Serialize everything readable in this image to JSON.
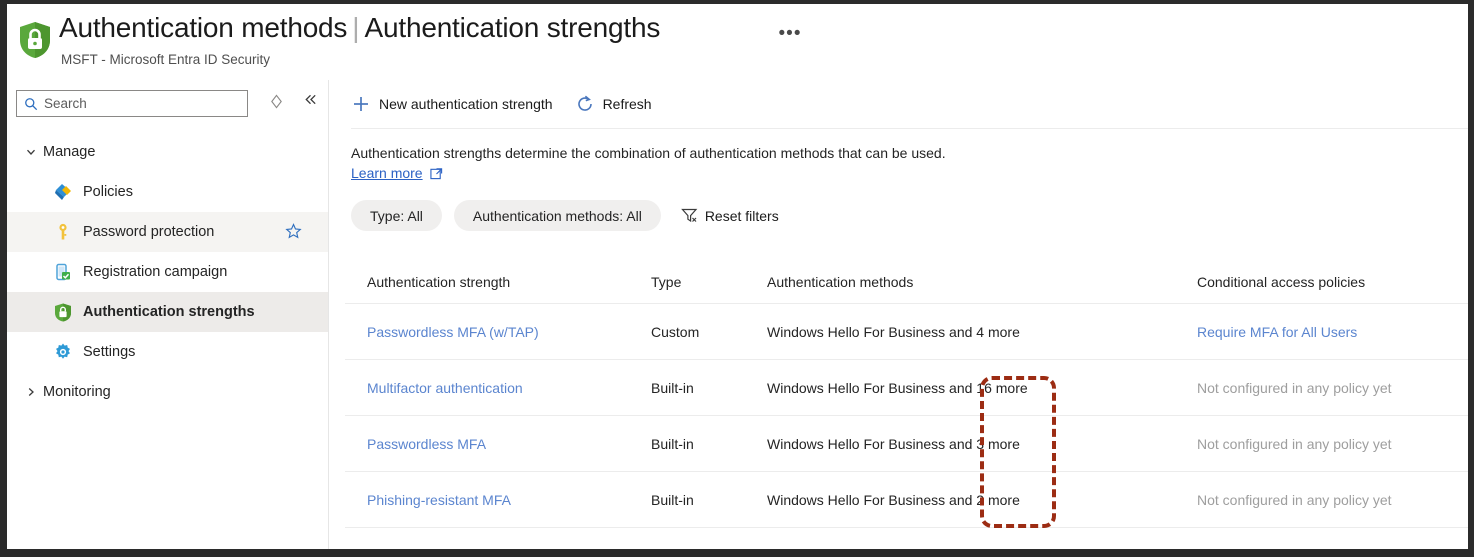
{
  "header": {
    "icon": "green-shield-lock-icon",
    "title_main": "Authentication methods",
    "title_separator": "|",
    "title_sub": "Authentication strengths",
    "overflow_label": "•••",
    "subtitle": "MSFT - Microsoft Entra ID Security"
  },
  "sidebar": {
    "search": {
      "placeholder": "Search",
      "value": "",
      "icon": "search-icon"
    },
    "refresh_icon": "refresh-diamond-icon",
    "collapse_icon": "double-chevron-left-icon",
    "groups": [
      {
        "label": "Manage",
        "expanded": true,
        "chevron": "⌄"
      },
      {
        "label": "Monitoring",
        "expanded": false,
        "chevron": "›"
      }
    ],
    "items": [
      {
        "label": "Policies",
        "icon": "policies-diamond-icon",
        "selected": false,
        "favorited": false
      },
      {
        "label": "Password protection",
        "icon": "key-icon",
        "selected": false,
        "hovered": true,
        "favorited": true,
        "star_icon": "star-outline-icon"
      },
      {
        "label": "Registration campaign",
        "icon": "phone-check-icon",
        "selected": false,
        "favorited": false
      },
      {
        "label": "Authentication strengths",
        "icon": "green-shield-lock-icon",
        "selected": true,
        "favorited": false
      },
      {
        "label": "Settings",
        "icon": "gear-icon",
        "selected": false,
        "favorited": false
      }
    ]
  },
  "toolbar": {
    "new_label": "New authentication strength",
    "new_icon": "plus-icon",
    "refresh_label": "Refresh",
    "refresh_icon": "refresh-circle-icon"
  },
  "content": {
    "description": "Authentication strengths determine the combination of authentication methods that can be used.",
    "learn_more": "Learn more",
    "learn_more_icon": "external-link-icon"
  },
  "filters": {
    "chips": [
      {
        "label": "Type: All"
      },
      {
        "label": "Authentication methods: All"
      }
    ],
    "reset_label": "Reset filters",
    "reset_icon": "funnel-clear-icon"
  },
  "table": {
    "columns": [
      "Authentication strength",
      "Type",
      "Authentication methods",
      "Conditional access policies"
    ],
    "rows": [
      {
        "name": "Passwordless MFA (w/TAP)",
        "type": "Custom",
        "methods": "Windows Hello For Business and 4 more",
        "policies": "Require MFA for All Users",
        "policies_is_link": true
      },
      {
        "name": "Multifactor authentication",
        "type": "Built-in",
        "methods": "Windows Hello For Business and 16 more",
        "policies": "Not configured in any policy yet",
        "policies_is_link": false
      },
      {
        "name": "Passwordless MFA",
        "type": "Built-in",
        "methods": "Windows Hello For Business and 3 more",
        "policies": "Not configured in any policy yet",
        "policies_is_link": false
      },
      {
        "name": "Phishing-resistant MFA",
        "type": "Built-in",
        "methods": "Windows Hello For Business and 2 more",
        "policies": "Not configured in any policy yet",
        "policies_is_link": false
      }
    ]
  },
  "annotation": {
    "shape": "dashed-rounded-rectangle",
    "color": "#9c2c13",
    "targets": "Type column Built-in values"
  },
  "colors": {
    "link": "#5b85cf",
    "accent_blue": "#2b61c4",
    "shield_green": "#5ab246",
    "annotation_red": "#9c2c13",
    "selected_row": "#edebe9",
    "frame_border": "#2b2b2b"
  }
}
